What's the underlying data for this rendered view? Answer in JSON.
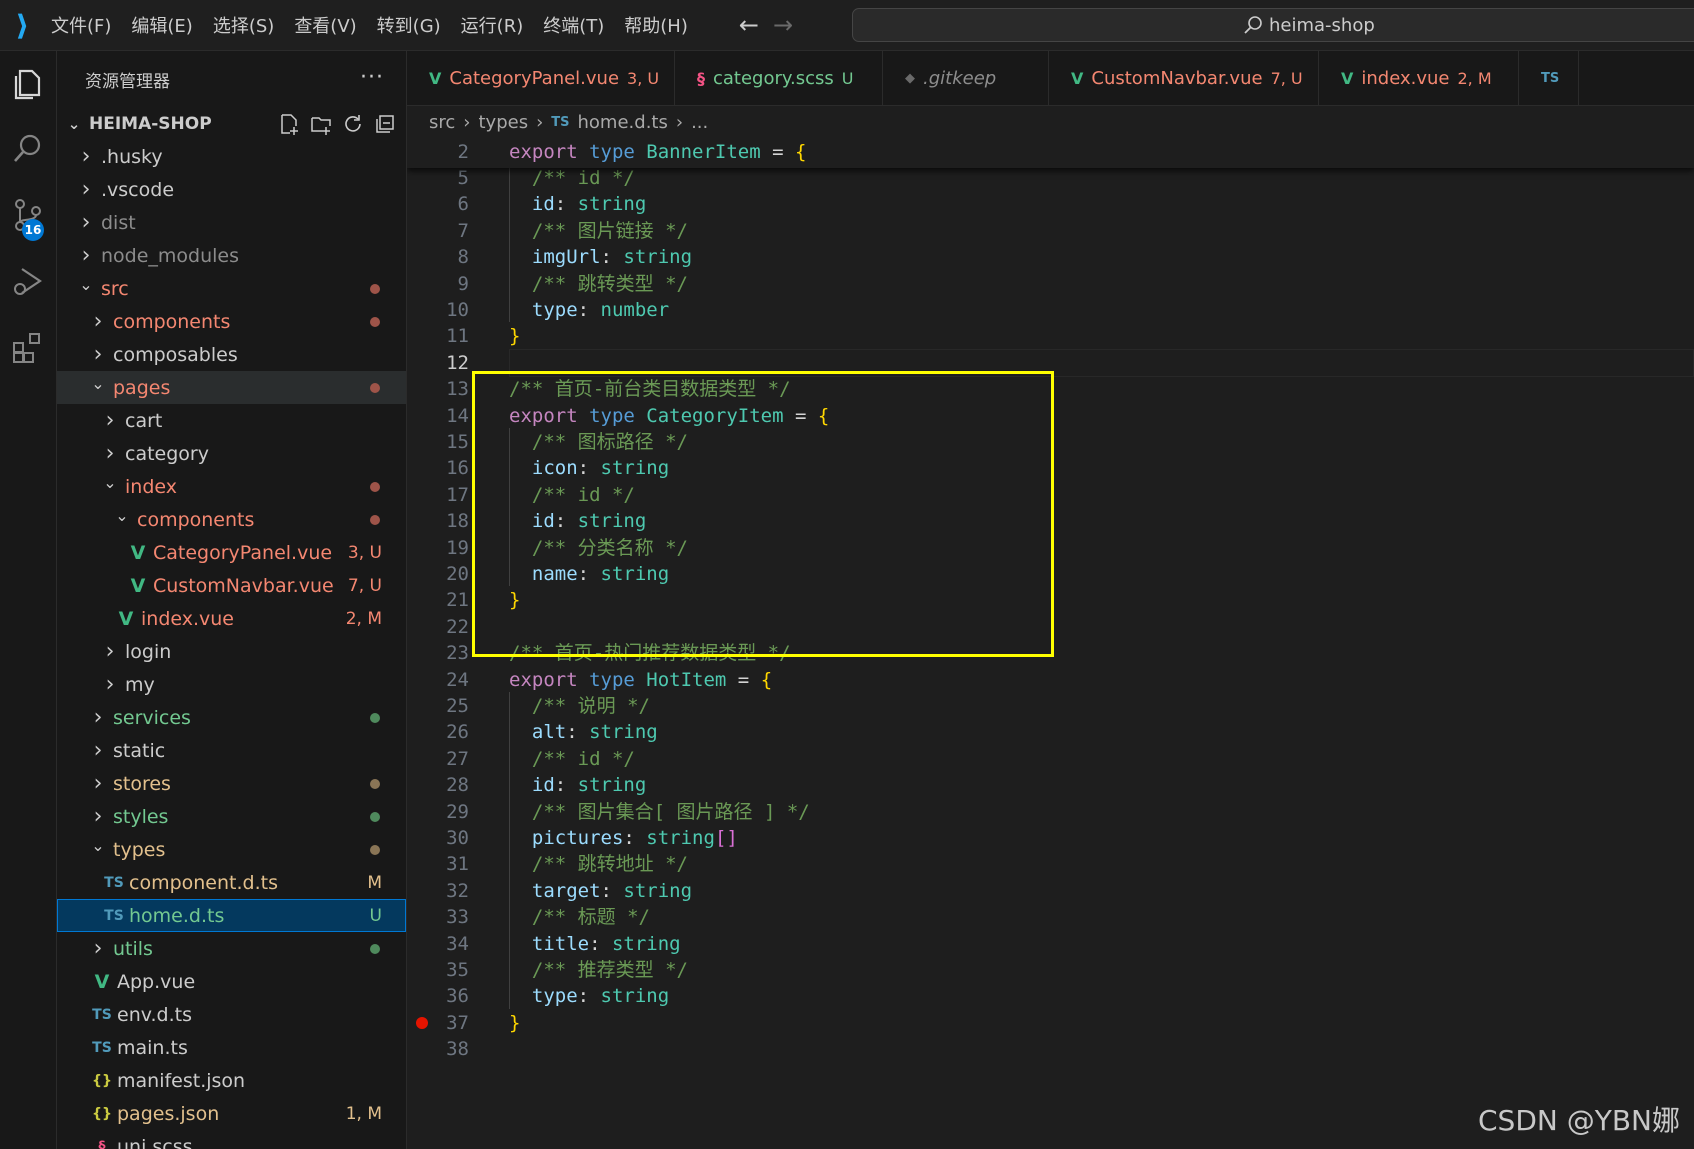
{
  "menu": [
    "文件(F)",
    "编辑(E)",
    "选择(S)",
    "查看(V)",
    "转到(G)",
    "运行(R)",
    "终端(T)",
    "帮助(H)"
  ],
  "search": {
    "text": "heima-shop"
  },
  "activity": {
    "scm_badge": "16"
  },
  "sidebar": {
    "title": "资源管理器",
    "more": "···",
    "project": "HEIMA-SHOP",
    "items": [
      {
        "label": ".husky",
        "kind": "folder",
        "open": false,
        "depth": 0,
        "color": "default"
      },
      {
        "label": ".vscode",
        "kind": "folder",
        "open": false,
        "depth": 0,
        "color": "default"
      },
      {
        "label": "dist",
        "kind": "folder",
        "open": false,
        "depth": 0,
        "color": "grey"
      },
      {
        "label": "node_modules",
        "kind": "folder",
        "open": false,
        "depth": 0,
        "color": "grey"
      },
      {
        "label": "src",
        "kind": "folder",
        "open": true,
        "depth": 0,
        "color": "red",
        "dot": "#9e5449"
      },
      {
        "label": "components",
        "kind": "folder",
        "open": false,
        "depth": 1,
        "color": "red",
        "dot": "#9e5449"
      },
      {
        "label": "composables",
        "kind": "folder",
        "open": false,
        "depth": 1,
        "color": "default"
      },
      {
        "label": "pages",
        "kind": "folder",
        "open": true,
        "depth": 1,
        "color": "red",
        "dot": "#9e5449",
        "state": "hover"
      },
      {
        "label": "cart",
        "kind": "folder",
        "open": false,
        "depth": 2,
        "color": "default"
      },
      {
        "label": "category",
        "kind": "folder",
        "open": false,
        "depth": 2,
        "color": "default"
      },
      {
        "label": "index",
        "kind": "folder",
        "open": true,
        "depth": 2,
        "color": "red",
        "dot": "#9e5449"
      },
      {
        "label": "components",
        "kind": "folder",
        "open": true,
        "depth": 3,
        "color": "red",
        "dot": "#9e5449"
      },
      {
        "label": "CategoryPanel.vue",
        "kind": "vue",
        "depth": 4,
        "color": "red",
        "status": "3, U"
      },
      {
        "label": "CustomNavbar.vue",
        "kind": "vue",
        "depth": 4,
        "color": "red",
        "status": "7, U"
      },
      {
        "label": "index.vue",
        "kind": "vue",
        "depth": 3,
        "color": "red",
        "status": "2, M"
      },
      {
        "label": "login",
        "kind": "folder",
        "open": false,
        "depth": 2,
        "color": "default"
      },
      {
        "label": "my",
        "kind": "folder",
        "open": false,
        "depth": 2,
        "color": "default"
      },
      {
        "label": "services",
        "kind": "folder",
        "open": false,
        "depth": 1,
        "color": "green",
        "dot": "#4f8a5d"
      },
      {
        "label": "static",
        "kind": "folder",
        "open": false,
        "depth": 1,
        "color": "default"
      },
      {
        "label": "stores",
        "kind": "folder",
        "open": false,
        "depth": 1,
        "color": "yellow",
        "dot": "#8a7556"
      },
      {
        "label": "styles",
        "kind": "folder",
        "open": false,
        "depth": 1,
        "color": "green",
        "dot": "#4f8a5d"
      },
      {
        "label": "types",
        "kind": "folder",
        "open": true,
        "depth": 1,
        "color": "yellow",
        "dot": "#8a7556"
      },
      {
        "label": "component.d.ts",
        "kind": "ts",
        "depth": 2,
        "color": "yellow",
        "status": "M"
      },
      {
        "label": "home.d.ts",
        "kind": "ts",
        "depth": 2,
        "color": "green",
        "status": "U",
        "state": "selected"
      },
      {
        "label": "utils",
        "kind": "folder",
        "open": false,
        "depth": 1,
        "color": "green",
        "dot": "#4f8a5d"
      },
      {
        "label": "App.vue",
        "kind": "vue",
        "depth": 1,
        "color": "default"
      },
      {
        "label": "env.d.ts",
        "kind": "ts",
        "depth": 1,
        "color": "default"
      },
      {
        "label": "main.ts",
        "kind": "ts",
        "depth": 1,
        "color": "default"
      },
      {
        "label": "manifest.json",
        "kind": "json",
        "depth": 1,
        "color": "default"
      },
      {
        "label": "pages.json",
        "kind": "json",
        "depth": 1,
        "color": "yellow",
        "status": "1, M"
      },
      {
        "label": "uni.scss",
        "kind": "scss",
        "depth": 1,
        "color": "default"
      }
    ]
  },
  "tabs": [
    {
      "label": "CategoryPanel.vue",
      "icon": "vue",
      "status": "3, U",
      "color": "#f48771"
    },
    {
      "label": "category.scss",
      "icon": "scss",
      "status": "U",
      "color": "#73c991"
    },
    {
      "label": ".gitkeep",
      "icon": "git",
      "status": "",
      "color": "#8c8c8c",
      "italic": true
    },
    {
      "label": "CustomNavbar.vue",
      "icon": "vue",
      "status": "7, U",
      "color": "#f48771"
    },
    {
      "label": "index.vue",
      "icon": "vue",
      "status": "2, M",
      "color": "#f48771"
    },
    {
      "label": "",
      "icon": "ts",
      "status": "",
      "color": "#cccccc"
    }
  ],
  "breadcrumb": [
    "src",
    "types",
    "home.d.ts",
    "..."
  ],
  "editor": {
    "sticky": {
      "num": "2",
      "tokens": [
        [
          "export ",
          "kw2"
        ],
        [
          "type ",
          "k"
        ],
        [
          "BannerItem",
          "tname"
        ],
        [
          " = ",
          "punct"
        ],
        [
          "{",
          "br"
        ]
      ]
    },
    "active_line": "12",
    "breakpoint_line": "37",
    "lines": [
      {
        "num": "5",
        "tokens": [
          [
            "  /** id */",
            "cm"
          ]
        ]
      },
      {
        "num": "6",
        "tokens": [
          [
            "  ",
            "punct"
          ],
          [
            "id",
            "prop"
          ],
          [
            ": ",
            "punct"
          ],
          [
            "string",
            "tname"
          ]
        ]
      },
      {
        "num": "7",
        "tokens": [
          [
            "  /** 图片链接 */",
            "cm"
          ]
        ]
      },
      {
        "num": "8",
        "tokens": [
          [
            "  ",
            "punct"
          ],
          [
            "imgUrl",
            "prop"
          ],
          [
            ": ",
            "punct"
          ],
          [
            "string",
            "tname"
          ]
        ]
      },
      {
        "num": "9",
        "tokens": [
          [
            "  /** 跳转类型 */",
            "cm"
          ]
        ]
      },
      {
        "num": "10",
        "tokens": [
          [
            "  ",
            "punct"
          ],
          [
            "type",
            "prop"
          ],
          [
            ": ",
            "punct"
          ],
          [
            "number",
            "tname"
          ]
        ]
      },
      {
        "num": "11",
        "tokens": [
          [
            "}",
            "br"
          ]
        ]
      },
      {
        "num": "12",
        "tokens": []
      },
      {
        "num": "13",
        "tokens": [
          [
            "/** 首页-前台类目数据类型 */",
            "cm"
          ]
        ]
      },
      {
        "num": "14",
        "tokens": [
          [
            "export ",
            "kw2"
          ],
          [
            "type ",
            "k"
          ],
          [
            "CategoryItem",
            "tname"
          ],
          [
            " = ",
            "punct"
          ],
          [
            "{",
            "br"
          ]
        ]
      },
      {
        "num": "15",
        "tokens": [
          [
            "  /** 图标路径 */",
            "cm"
          ]
        ]
      },
      {
        "num": "16",
        "tokens": [
          [
            "  ",
            "punct"
          ],
          [
            "icon",
            "prop"
          ],
          [
            ": ",
            "punct"
          ],
          [
            "string",
            "tname"
          ]
        ]
      },
      {
        "num": "17",
        "tokens": [
          [
            "  /** id */",
            "cm"
          ]
        ]
      },
      {
        "num": "18",
        "tokens": [
          [
            "  ",
            "punct"
          ],
          [
            "id",
            "prop"
          ],
          [
            ": ",
            "punct"
          ],
          [
            "string",
            "tname"
          ]
        ]
      },
      {
        "num": "19",
        "tokens": [
          [
            "  /** 分类名称 */",
            "cm"
          ]
        ]
      },
      {
        "num": "20",
        "tokens": [
          [
            "  ",
            "punct"
          ],
          [
            "name",
            "prop"
          ],
          [
            ": ",
            "punct"
          ],
          [
            "string",
            "tname"
          ]
        ]
      },
      {
        "num": "21",
        "tokens": [
          [
            "}",
            "br"
          ]
        ]
      },
      {
        "num": "22",
        "tokens": []
      },
      {
        "num": "23",
        "tokens": [
          [
            "/** 首页-热门推荐数据类型 */",
            "cm"
          ]
        ]
      },
      {
        "num": "24",
        "tokens": [
          [
            "export ",
            "kw2"
          ],
          [
            "type ",
            "k"
          ],
          [
            "HotItem",
            "tname"
          ],
          [
            " = ",
            "punct"
          ],
          [
            "{",
            "br"
          ]
        ]
      },
      {
        "num": "25",
        "tokens": [
          [
            "  /** 说明 */",
            "cm"
          ]
        ]
      },
      {
        "num": "26",
        "tokens": [
          [
            "  ",
            "punct"
          ],
          [
            "alt",
            "prop"
          ],
          [
            ": ",
            "punct"
          ],
          [
            "string",
            "tname"
          ]
        ]
      },
      {
        "num": "27",
        "tokens": [
          [
            "  /** id */",
            "cm"
          ]
        ]
      },
      {
        "num": "28",
        "tokens": [
          [
            "  ",
            "punct"
          ],
          [
            "id",
            "prop"
          ],
          [
            ": ",
            "punct"
          ],
          [
            "string",
            "tname"
          ]
        ]
      },
      {
        "num": "29",
        "tokens": [
          [
            "  /** 图片集合[ 图片路径 ] */",
            "cm"
          ]
        ]
      },
      {
        "num": "30",
        "tokens": [
          [
            "  ",
            "punct"
          ],
          [
            "pictures",
            "prop"
          ],
          [
            ": ",
            "punct"
          ],
          [
            "string",
            "tname"
          ],
          [
            "[]",
            "br2"
          ]
        ]
      },
      {
        "num": "31",
        "tokens": [
          [
            "  /** 跳转地址 */",
            "cm"
          ]
        ]
      },
      {
        "num": "32",
        "tokens": [
          [
            "  ",
            "punct"
          ],
          [
            "target",
            "prop"
          ],
          [
            ": ",
            "punct"
          ],
          [
            "string",
            "tname"
          ]
        ]
      },
      {
        "num": "33",
        "tokens": [
          [
            "  /** 标题 */",
            "cm"
          ]
        ]
      },
      {
        "num": "34",
        "tokens": [
          [
            "  ",
            "punct"
          ],
          [
            "title",
            "prop"
          ],
          [
            ": ",
            "punct"
          ],
          [
            "string",
            "tname"
          ]
        ]
      },
      {
        "num": "35",
        "tokens": [
          [
            "  /** 推荐类型 */",
            "cm"
          ]
        ]
      },
      {
        "num": "36",
        "tokens": [
          [
            "  ",
            "punct"
          ],
          [
            "type",
            "prop"
          ],
          [
            ": ",
            "punct"
          ],
          [
            "string",
            "tname"
          ]
        ]
      },
      {
        "num": "37",
        "tokens": [
          [
            "}",
            "br"
          ]
        ]
      },
      {
        "num": "38",
        "tokens": []
      }
    ]
  },
  "watermark": "CSDN @YBN娜"
}
